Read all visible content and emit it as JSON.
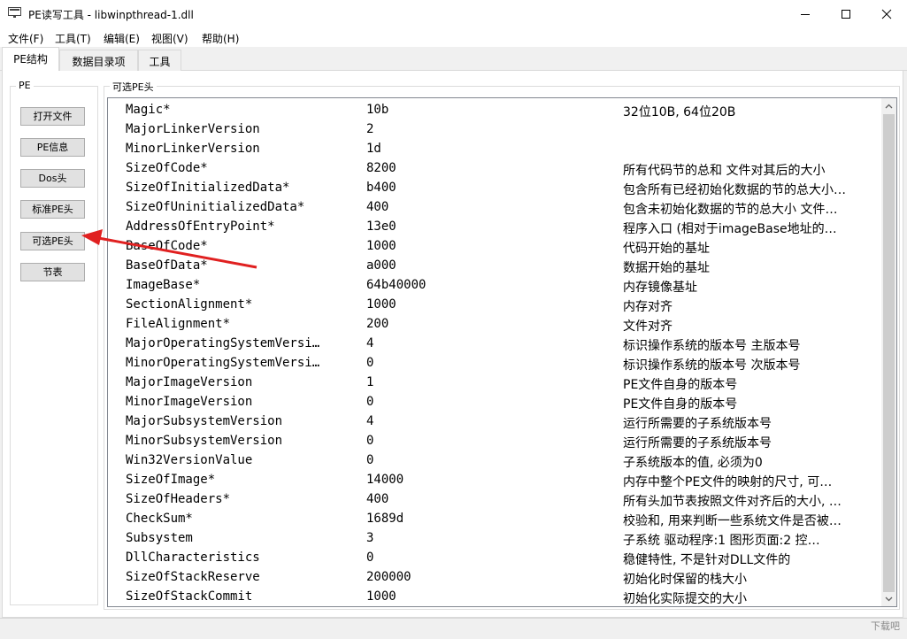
{
  "window": {
    "title": "PE读写工具 - libwinpthread-1.dll",
    "minimize_icon": "minimize-icon",
    "maximize_icon": "maximize-icon",
    "close_icon": "close-icon"
  },
  "menu": [
    "文件(F)",
    "工具(T)",
    "编辑(E)",
    "视图(V)",
    "帮助(H)"
  ],
  "tabs": [
    "PE结构",
    "数据目录项",
    "工具"
  ],
  "sidebar": {
    "group_title": "PE",
    "buttons": [
      "打开文件",
      "PE信息",
      "Dos头",
      "标准PE头",
      "可选PE头",
      "节表"
    ]
  },
  "panel": {
    "group_title": "可选PE头",
    "rows": [
      [
        "Magic*",
        "10b",
        "32位10B, 64位20B"
      ],
      [
        "MajorLinkerVersion",
        "2",
        ""
      ],
      [
        "MinorLinkerVersion",
        "1d",
        ""
      ],
      [
        "SizeOfCode*",
        "8200",
        "所有代码节的总和 文件对其后的大小"
      ],
      [
        "SizeOfInitializedData*",
        "b400",
        "包含所有已经初始化数据的节的总大小…"
      ],
      [
        "SizeOfUninitializedData*",
        "400",
        "包含未初始化数据的节的总大小 文件…"
      ],
      [
        "AddressOfEntryPoint*",
        "13e0",
        "程序入口 (相对于imageBase地址的…"
      ],
      [
        "BaseOfCode*",
        "1000",
        "代码开始的基址"
      ],
      [
        "BaseOfData*",
        "a000",
        "数据开始的基址"
      ],
      [
        "ImageBase*",
        "64b40000",
        "内存镜像基址"
      ],
      [
        "SectionAlignment*",
        "1000",
        "内存对齐"
      ],
      [
        "FileAlignment*",
        "200",
        "文件对齐"
      ],
      [
        "MajorOperatingSystemVersi…",
        "4",
        "标识操作系统的版本号 主版本号"
      ],
      [
        "MinorOperatingSystemVersi…",
        "0",
        "标识操作系统的版本号 次版本号"
      ],
      [
        "MajorImageVersion",
        "1",
        "PE文件自身的版本号"
      ],
      [
        "MinorImageVersion",
        "0",
        "PE文件自身的版本号"
      ],
      [
        "MajorSubsystemVersion",
        "4",
        "运行所需要的子系统版本号"
      ],
      [
        "MinorSubsystemVersion",
        "0",
        "运行所需要的子系统版本号"
      ],
      [
        "Win32VersionValue",
        "0",
        "子系统版本的值, 必须为0"
      ],
      [
        "SizeOfImage*",
        "14000",
        "内存中整个PE文件的映射的尺寸, 可…"
      ],
      [
        "SizeOfHeaders*",
        "400",
        "所有头加节表按照文件对齐后的大小, …"
      ],
      [
        "CheckSum*",
        "1689d",
        "校验和, 用来判断一些系统文件是否被…"
      ],
      [
        "Subsystem",
        "3",
        "子系统 驱动程序:1 图形页面:2 控…"
      ],
      [
        "DllCharacteristics",
        "0",
        "稳健特性, 不是针对DLL文件的"
      ],
      [
        "SizeOfStackReserve",
        "200000",
        "初始化时保留的栈大小"
      ],
      [
        "SizeOfStackCommit",
        "1000",
        "初始化实际提交的大小"
      ]
    ]
  },
  "watermark": "下载吧",
  "colors": {
    "annotation_arrow": "#e02020",
    "scroll_thumb": "#cdcdcd"
  }
}
